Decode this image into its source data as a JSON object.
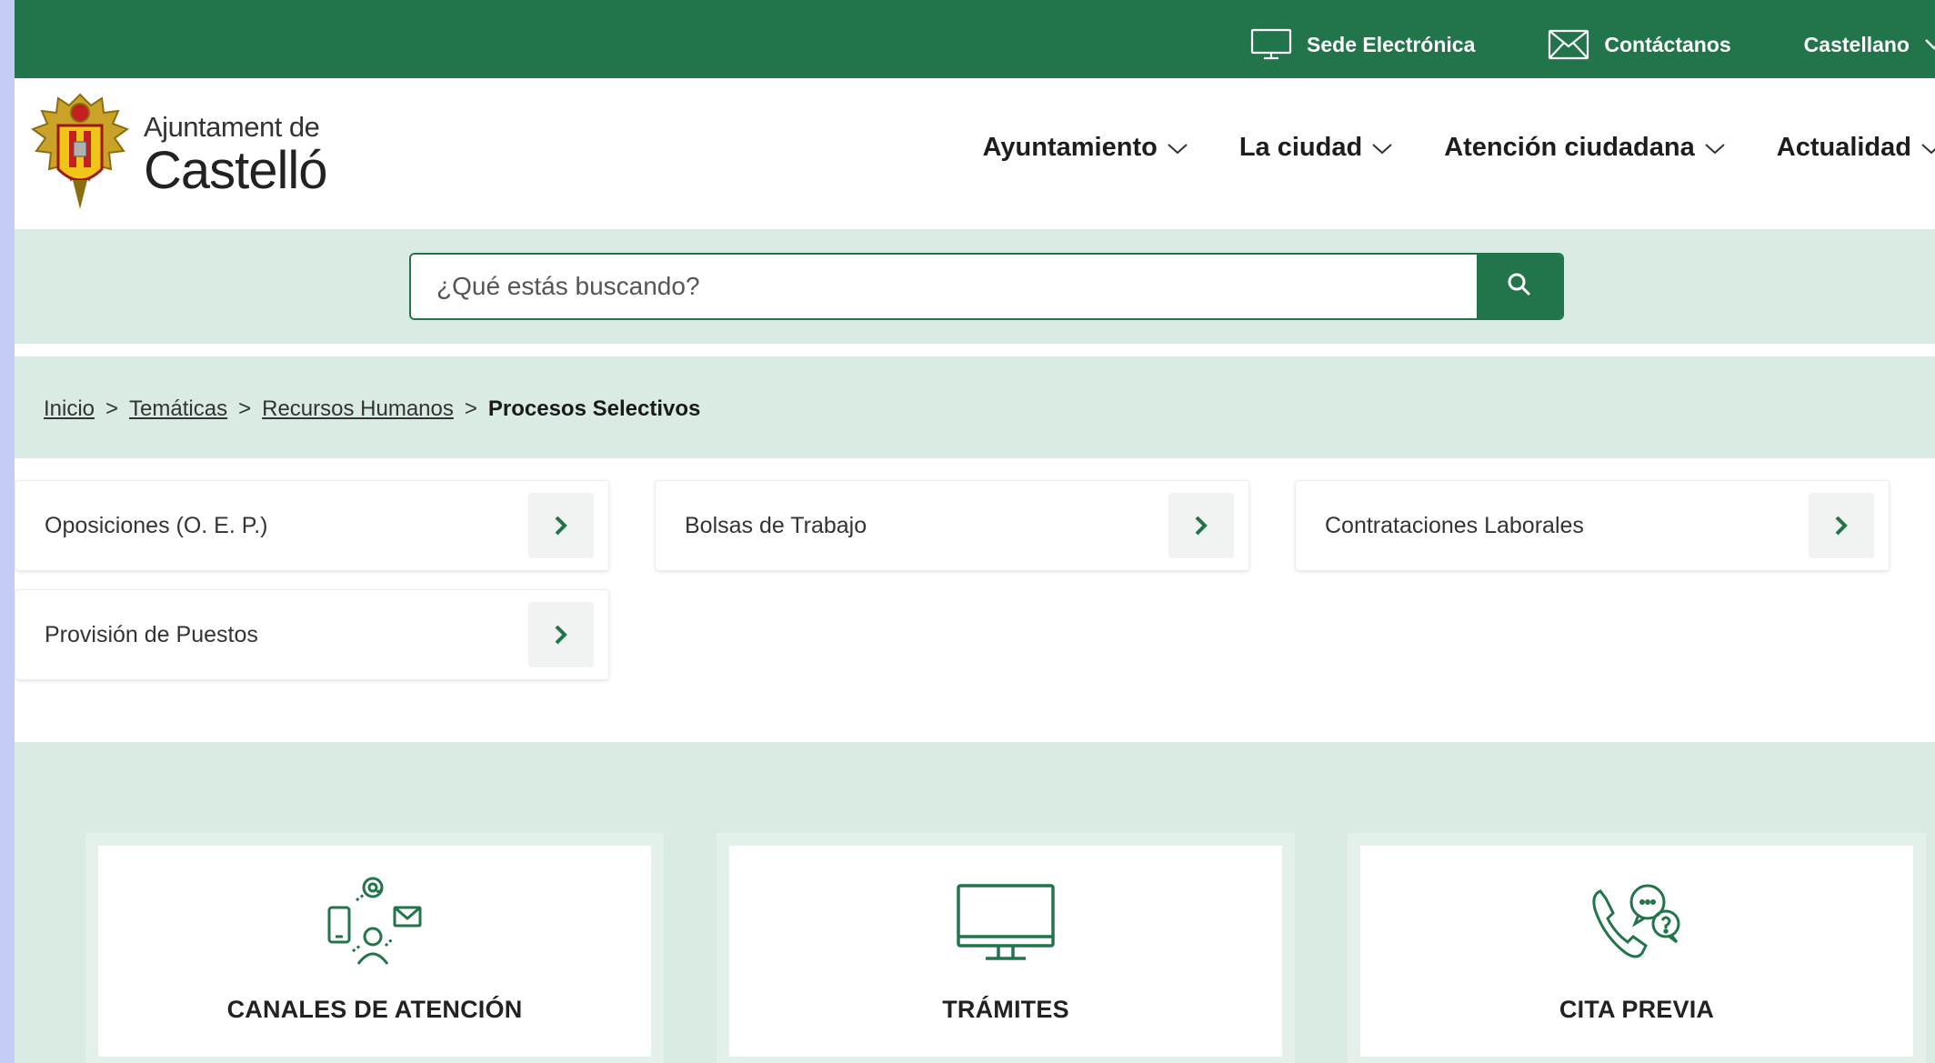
{
  "utility_bar": {
    "sede": "Sede Electrónica",
    "contact": "Contáctanos",
    "language": "Castellano"
  },
  "logo": {
    "line1": "Ajuntament de",
    "line2": "Castelló"
  },
  "nav": [
    {
      "label": "Ayuntamiento"
    },
    {
      "label": "La ciudad"
    },
    {
      "label": "Atención ciudadana"
    },
    {
      "label": "Actualidad"
    }
  ],
  "search": {
    "placeholder": "¿Qué estás buscando?"
  },
  "breadcrumb": {
    "items": [
      "Inicio",
      "Temáticas",
      "Recursos Humanos"
    ],
    "separator": ">",
    "current": "Procesos Selectivos"
  },
  "cards": [
    {
      "label": "Oposiciones (O. E. P.)"
    },
    {
      "label": "Bolsas de Trabajo"
    },
    {
      "label": "Contrataciones Laborales"
    },
    {
      "label": "Provisión de Puestos"
    }
  ],
  "services": [
    {
      "label": "CANALES DE ATENCIÓN",
      "icon": "contact-channels-icon"
    },
    {
      "label": "TRÁMITES",
      "icon": "monitor-icon"
    },
    {
      "label": "CITA PREVIA",
      "icon": "phone-chat-icon"
    }
  ],
  "colors": {
    "brand_green": "#22744a",
    "light_green": "#d9ebe3",
    "side_background": "#c5ccf6"
  }
}
